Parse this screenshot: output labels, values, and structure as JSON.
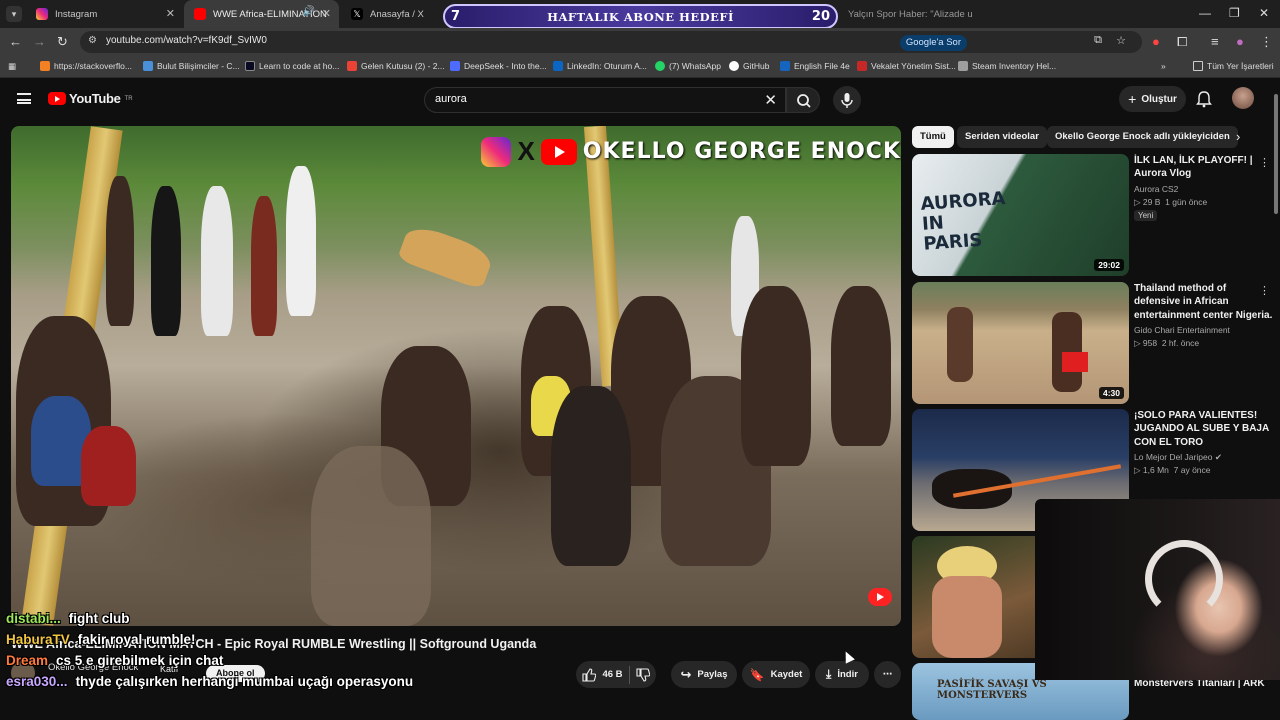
{
  "tabs": [
    {
      "label": "Instagram",
      "color": "#e1306c"
    },
    {
      "label": "WWE Africa-ELIMINATION",
      "color": "#ff0000",
      "active": true
    },
    {
      "label": "Anasayfa / X",
      "color": "#000000"
    },
    {
      "label": "Yalçın Spor Haber: \"Alizade u",
      "color": "#1a73e8"
    }
  ],
  "overlay": {
    "left_num": "7",
    "title": "HAFTALIK ABONE HEDEFİ",
    "right_num": "20"
  },
  "address": {
    "url": "youtube.com/watch?v=fK9df_SvIW0",
    "google_btn": "Google'a Sor"
  },
  "bookmarks": [
    {
      "label": "https://stackoverflo...",
      "color": "#f48024"
    },
    {
      "label": "Bulut Bilişimciler - C...",
      "color": "#4a90d9"
    },
    {
      "label": "Learn to code at ho...",
      "color": "#0a0a23"
    },
    {
      "label": "Gelen Kutusu (2) - 2...",
      "color": "#ea4335"
    },
    {
      "label": "DeepSeek - Into the...",
      "color": "#4d6bfe"
    },
    {
      "label": "LinkedIn: Oturum A...",
      "color": "#0a66c2"
    },
    {
      "label": "(7) WhatsApp",
      "color": "#25d366"
    },
    {
      "label": "GitHub",
      "color": "#ffffff"
    },
    {
      "label": "English File 4e",
      "color": "#1565c0"
    },
    {
      "label": "Vekalet Yönetim Sist...",
      "color": "#c62828"
    },
    {
      "label": "Steam Inventory Hel...",
      "color": "#9e9e9e"
    }
  ],
  "bookmarks_all": "Tüm Yer İşaretleri",
  "youtube": {
    "logo": "YouTube",
    "logo_region": "TR",
    "search_value": "aurora",
    "create_label": "Oluştur"
  },
  "video": {
    "watermark": "OKELLO GEORGE ENOCK",
    "title": "WWE Africa-ELIMINATION MATCH - Epic Royal RUMBLE Wrestling || Softground Uganda",
    "channel": "Okello George Enock",
    "join_label": "Katıl",
    "subscribe_label": "Abone ol",
    "likes": "46 B",
    "share_label": "Paylaş",
    "save_label": "Kaydet",
    "download_label": "İndir"
  },
  "chat": [
    {
      "user": "distabi...",
      "msg": "fight club"
    },
    {
      "user": "HaburaTV",
      "msg": "fakir royal rumble!"
    },
    {
      "user": "Dream",
      "msg": "cs 5 e girebilmek için chat"
    },
    {
      "user": "esra030...",
      "msg": "thyde çalışırken herhangi mumbai uçağı operasyonu"
    }
  ],
  "chips": [
    "Tümü",
    "Seriden videolar",
    "Okello George Enock adlı yükleyiciden"
  ],
  "recommendations": [
    {
      "title": "İLK LAN, İLK PLAYOFF! | Aurora Vlog",
      "channel": "Aurora CS2",
      "views": "29 B",
      "age": "1 gün önce",
      "badge": "Yeni",
      "duration": "29:02",
      "thumb_text": "AURORA IN PARIS",
      "thumb_color": "#2d5a3d"
    },
    {
      "title": "Thailand method of defensive in African entertainment center Nigeria.",
      "channel": "Gido Chari Entertainment",
      "views": "958",
      "age": "2 hf. önce",
      "badge": "",
      "duration": "4:30",
      "thumb_text": "",
      "thumb_color": "#a88a66"
    },
    {
      "title": "¡SOLO PARA VALIENTES! JUGANDO AL SUBE Y BAJA CON EL TORO",
      "channel": "Lo Mejor Del Jaripeo",
      "views": "1,6 Mn",
      "age": "7 ay önce",
      "badge": "",
      "duration": "",
      "thumb_text": "",
      "thumb_color": "#2a3f66"
    },
    {
      "title": "",
      "channel": "",
      "views": "",
      "age": "",
      "badge": "",
      "duration": "",
      "thumb_text": "",
      "thumb_color": "#7a5a3a"
    },
    {
      "title": "Monstervers Titanları | ARK",
      "channel": "",
      "views": "",
      "age": "",
      "badge": "",
      "duration": "",
      "thumb_text": "PASİFİK SAVAŞI VS MONSTERVERS",
      "thumb_color": "#9cc4e0"
    }
  ]
}
